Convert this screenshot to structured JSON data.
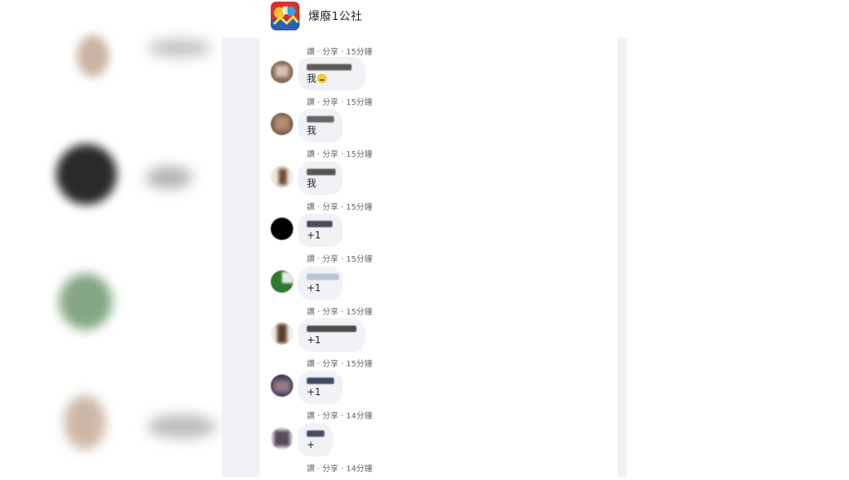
{
  "header": {
    "page_name": "爆廢1公社"
  },
  "top_action": {
    "label": "讚 · 分享 · 15分鐘"
  },
  "comments": [
    {
      "text": "我",
      "has_emoji": true,
      "like": "讚",
      "share": "分享",
      "time": "15分鐘"
    },
    {
      "text": "我",
      "has_emoji": false,
      "like": "讚",
      "share": "分享",
      "time": "15分鐘"
    },
    {
      "text": "我",
      "has_emoji": false,
      "like": "讚",
      "share": "分享",
      "time": "15分鐘"
    },
    {
      "text": "+1",
      "has_emoji": false,
      "like": "讚",
      "share": "分享",
      "time": "15分鐘"
    },
    {
      "text": "+1",
      "has_emoji": false,
      "like": "讚",
      "share": "分享",
      "time": "15分鐘"
    },
    {
      "text": "+1",
      "has_emoji": false,
      "like": "讚",
      "share": "分享",
      "time": "15分鐘"
    },
    {
      "text": "+1",
      "has_emoji": false,
      "like": "讚",
      "share": "分享",
      "time": "14分鐘"
    },
    {
      "text": "+",
      "has_emoji": false,
      "like": "讚",
      "share": "分享",
      "time": "14分鐘"
    }
  ],
  "colors": {
    "panel_bg": "#f0f2f5",
    "bubble_bg": "#f0f2f5",
    "meta_text": "#65676b"
  }
}
